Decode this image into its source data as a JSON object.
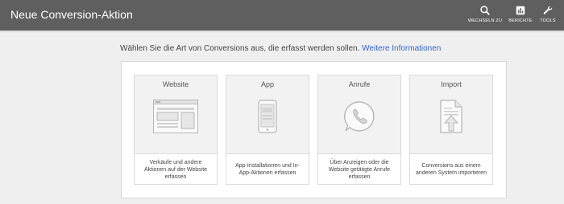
{
  "header": {
    "title": "Neue Conversion-Aktion",
    "tools": [
      {
        "label": "WECHSELN ZU",
        "icon": "search-icon"
      },
      {
        "label": "BERICHTE",
        "icon": "reports-icon"
      },
      {
        "label": "TOOLS",
        "icon": "wrench-icon"
      }
    ]
  },
  "intro": {
    "text": "Wählen Sie die Art von Conversions aus, die erfasst werden sollen.",
    "link": "Weitere Informationen"
  },
  "cards": [
    {
      "name": "Website",
      "description": "Verkäufe und andere Aktionen auf der Website erfassen",
      "icon": "website-icon"
    },
    {
      "name": "App",
      "description": "App-Installationen und In-App-Aktionen erfassen",
      "icon": "phone-icon"
    },
    {
      "name": "Anrufe",
      "description": "Über Anzeigen oder die Website getätigte Anrufe erfassen",
      "icon": "call-icon"
    },
    {
      "name": "Import",
      "description": "Conversions aus einem anderen System importieren",
      "icon": "import-icon"
    }
  ],
  "colors": {
    "header": "#5f5f5f",
    "link": "#3367d6",
    "background": "#efefef"
  }
}
